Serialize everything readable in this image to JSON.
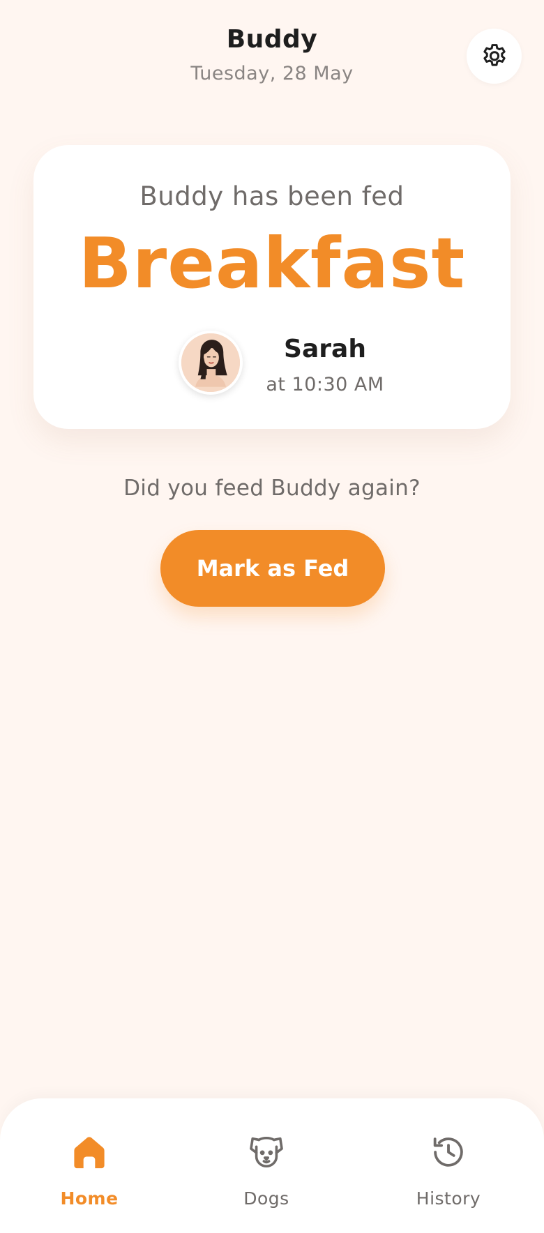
{
  "header": {
    "dog_name": "Buddy",
    "date": "Tuesday, 28 May",
    "settings_icon": "gear-icon"
  },
  "fed_card": {
    "status_text": "Buddy has been fed",
    "meal": "Breakfast",
    "feeder": {
      "name": "Sarah",
      "time": "at 10:30 AM",
      "avatar_icon": "avatar"
    }
  },
  "action": {
    "prompt": "Did you feed Buddy again?",
    "button_label": "Mark as Fed"
  },
  "nav": {
    "items": [
      {
        "label": "Home",
        "icon": "home-icon",
        "active": true
      },
      {
        "label": "Dogs",
        "icon": "dog-icon",
        "active": false
      },
      {
        "label": "History",
        "icon": "history-icon",
        "active": false
      }
    ]
  },
  "colors": {
    "accent": "#F28C28",
    "background": "#FFF6F1",
    "card": "#FFFFFF",
    "text_primary": "#1E1E1E",
    "text_secondary": "#6F6B69"
  }
}
